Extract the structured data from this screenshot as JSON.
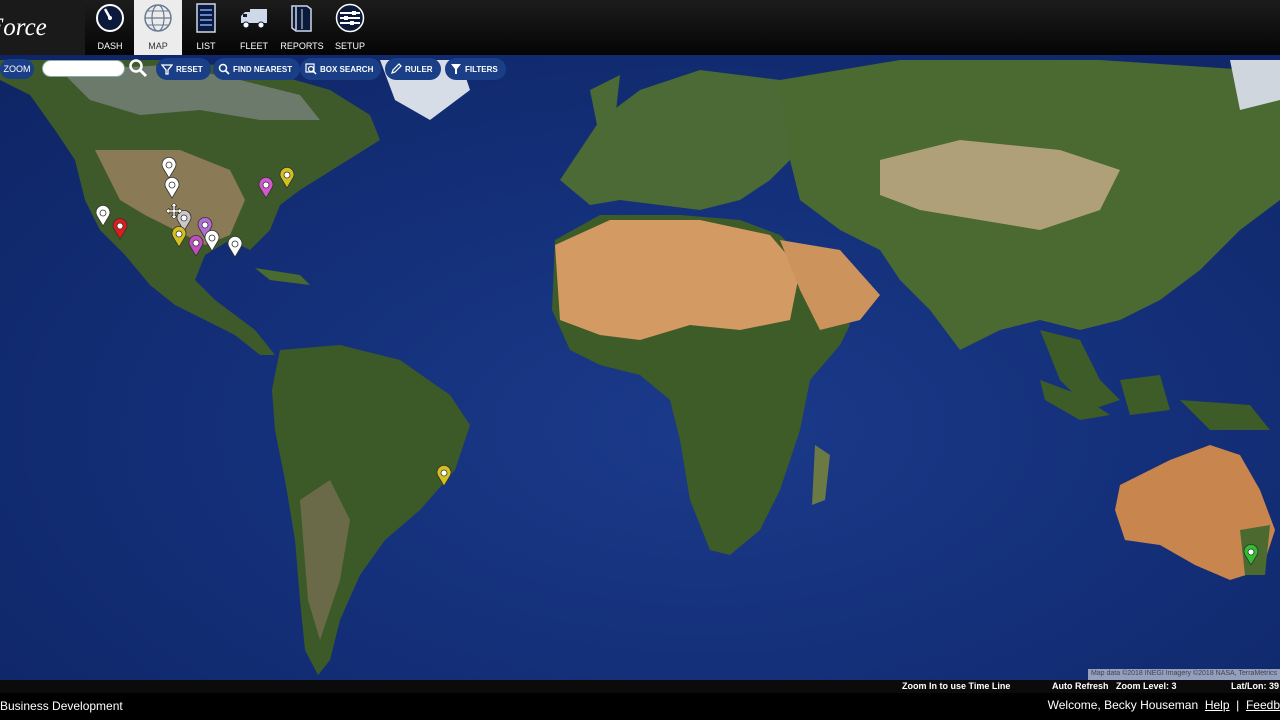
{
  "brand": {
    "logo_text": "Force"
  },
  "nav": [
    {
      "label": "DASH",
      "icon": "dashboard-gauge-icon"
    },
    {
      "label": "MAP",
      "icon": "globe-icon",
      "active": true
    },
    {
      "label": "LIST",
      "icon": "list-document-icon"
    },
    {
      "label": "FLEET",
      "icon": "truck-icon"
    },
    {
      "label": "REPORTS",
      "icon": "reports-book-icon"
    },
    {
      "label": "SETUP",
      "icon": "setup-sliders-icon"
    }
  ],
  "toolbar": {
    "zoom_label": "ZOOM",
    "search_placeholder": "",
    "reset": "RESET",
    "find_nearest": "FIND NEAREST",
    "box_search": "BOX SEARCH",
    "ruler": "RULER",
    "filters": "FILTERS"
  },
  "map": {
    "attribution": "Map data ©2018 INEGI Imagery ©2018 NASA, TerraMetrics",
    "pins": [
      {
        "color": "#ffffff"
      },
      {
        "color": "#ffffff"
      },
      {
        "color": "#ffffff"
      },
      {
        "color": "#e21a1a"
      },
      {
        "color": "#c9c9c9"
      },
      {
        "color": "#b36bd6"
      },
      {
        "color": "#d3c01f"
      },
      {
        "color": "#c24fc2"
      },
      {
        "color": "#ffffff"
      },
      {
        "color": "#ffffff"
      },
      {
        "color": "#d05acb"
      },
      {
        "color": "#d3c01f"
      },
      {
        "color": "#d3c01f"
      },
      {
        "color": "#2fbf2f"
      }
    ]
  },
  "status_bar": {
    "timeline_hint": "Zoom In to use Time Line",
    "auto_refresh": "Auto Refresh",
    "zoom_level": "Zoom Level: 3",
    "latlon": "Lat/Lon: 39"
  },
  "footer": {
    "company": "Business Development",
    "welcome": "Welcome, Becky Houseman",
    "help": "Help",
    "separator": "|",
    "feedback": "Feedb"
  }
}
